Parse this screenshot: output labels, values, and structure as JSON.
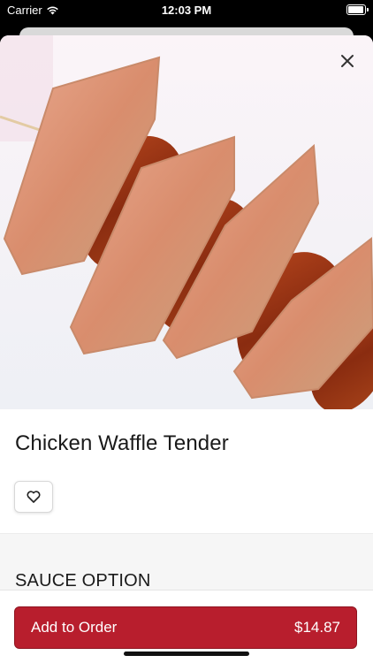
{
  "status_bar": {
    "carrier": "Carrier",
    "time": "12:03 PM",
    "battery_level": 0.95
  },
  "product": {
    "name": "Chicken Waffle Tender",
    "image_icon": "chicken-waffle-skewer-photo",
    "close_icon": "close-icon",
    "favorite_icon": "heart-icon"
  },
  "options": {
    "section_title": "SAUCE OPTION"
  },
  "footer": {
    "add_label": "Add to Order",
    "price": "$14.87"
  },
  "colors": {
    "accent": "#b81e2d",
    "accent_border": "#8e1420"
  }
}
